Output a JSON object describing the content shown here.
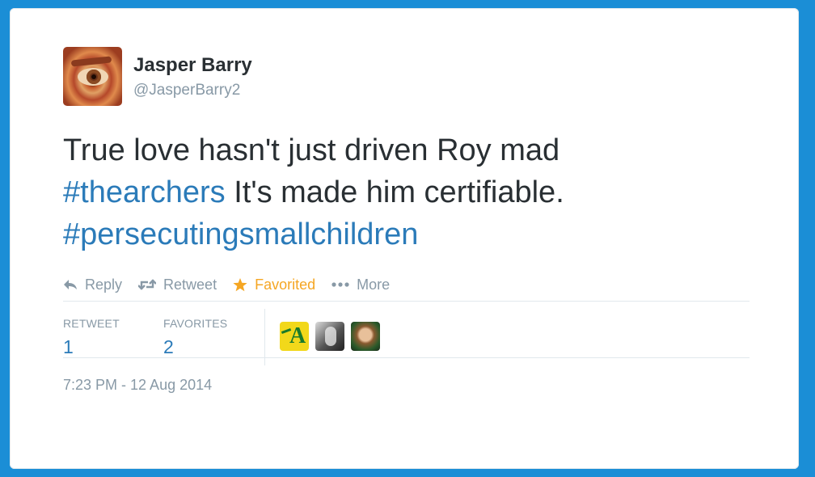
{
  "user": {
    "name": "Jasper Barry",
    "handle": "@JasperBarry2"
  },
  "tweet": {
    "text_part1": "True love hasn't just driven Roy mad",
    "hashtag1": "#thearchers",
    "text_part2": " It's made him certifiable.",
    "hashtag2": "#persecutingsmallchildren"
  },
  "actions": {
    "reply": "Reply",
    "retweet": "Retweet",
    "favorited": "Favorited",
    "more": "More"
  },
  "stats": {
    "retweet_label": "RETWEET",
    "retweet_count": "1",
    "favorites_label": "FAVORITES",
    "favorites_count": "2",
    "avatar_icons": [
      "archers-logo-avatar",
      "grayscale-photo-avatar",
      "face-photo-avatar"
    ]
  },
  "timestamp": "7:23 PM - 12 Aug 2014",
  "colors": {
    "frame": "#1b8ed6",
    "link": "#2b7bb9",
    "favorite": "#f5a623",
    "muted": "#8899a6",
    "text": "#292f33"
  }
}
